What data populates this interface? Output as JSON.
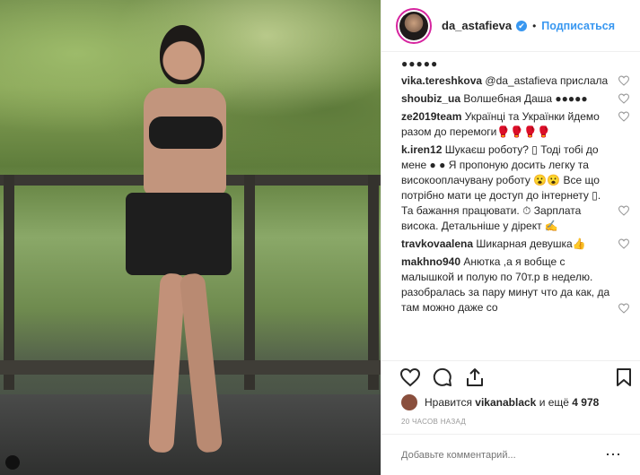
{
  "header": {
    "username": "da_astafieva",
    "verified": "✔",
    "separator": "•",
    "follow_label": "Подписаться"
  },
  "comments": {
    "top_text": "●●●●●",
    "items": [
      {
        "user": "vika.tereshkova",
        "text": "@da_astafieva прислала"
      },
      {
        "user": "shoubiz_ua",
        "text": "Волшебная Даша ●●●●●"
      },
      {
        "user": "ze2019team",
        "text": "Українці та Українки йдемо разом до перемоги🥊🥊🥊🥊"
      },
      {
        "user": "k.iren12",
        "text": "Шукаєш роботу? ▯ Тоді тобі до мене ● ● Я пропоную досить легку та високооплачувану роботу 😮😮 Все що потрібно мати це доступ до інтернету ▯. Та бажання працювати. ⏱ Зарплата висока. Детальніше у дірект ✍"
      },
      {
        "user": "travkovaalena",
        "text": "Шикарная девушка👍"
      },
      {
        "user": "makhno940",
        "text": "Анютка ,а я вобще с малышкой и полую по 70т.р в неделю. разобралась за пару минут что да как, да там можно даже со"
      }
    ]
  },
  "likes": {
    "prefix": "Нравится",
    "user": "vikanablack",
    "suffix": "и ещё",
    "count": "4 978"
  },
  "time_label": "20 ЧАСОВ НАЗАД",
  "add_comment": {
    "placeholder": "Добавьте комментарий...",
    "more": "⋯"
  }
}
